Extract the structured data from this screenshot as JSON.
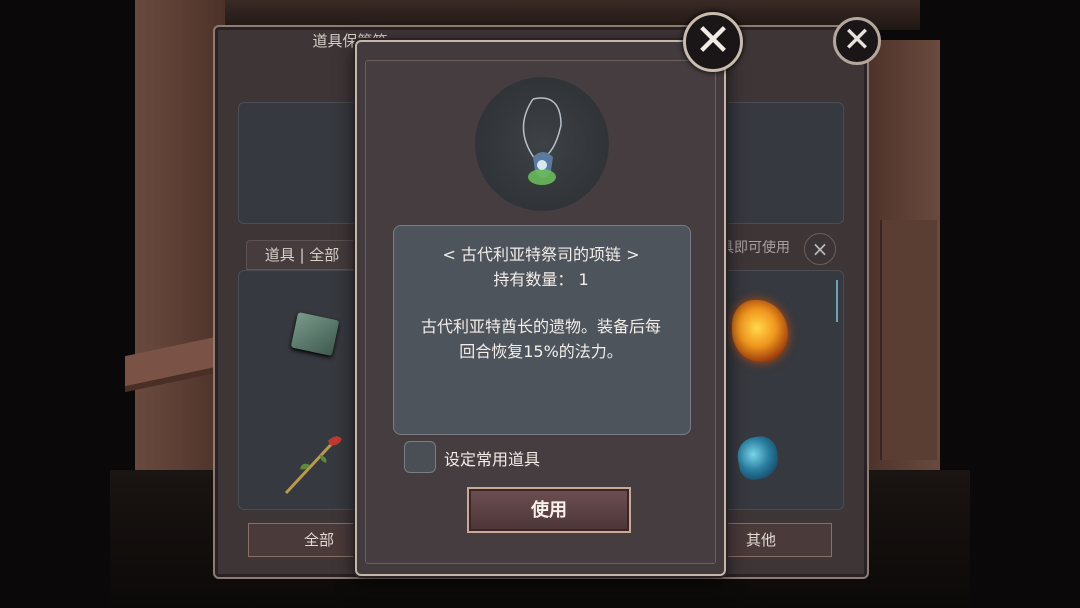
{
  "background_panel": {
    "title": "道具保管箱",
    "tab_label": "道具 | 全部",
    "hint_text": "具即可使用",
    "bottom_tabs": [
      "全部",
      "其他"
    ]
  },
  "item_detail": {
    "name": "< 古代利亚特祭司的项链 >",
    "quantity_label": "持有数量： 1",
    "description_line1": "古代利亚特酋长的遗物。装备后每",
    "description_line2": "回合恢复15%的法力。",
    "favorite_label": "设定常用道具",
    "use_button_label": "使用"
  },
  "icons": {
    "close": "close-x-icon",
    "necklace": "necklace-icon"
  },
  "colors": {
    "panel_bg": "#423a3d",
    "info_box": "#4e545c",
    "border_gold": "#c4b6aa"
  }
}
